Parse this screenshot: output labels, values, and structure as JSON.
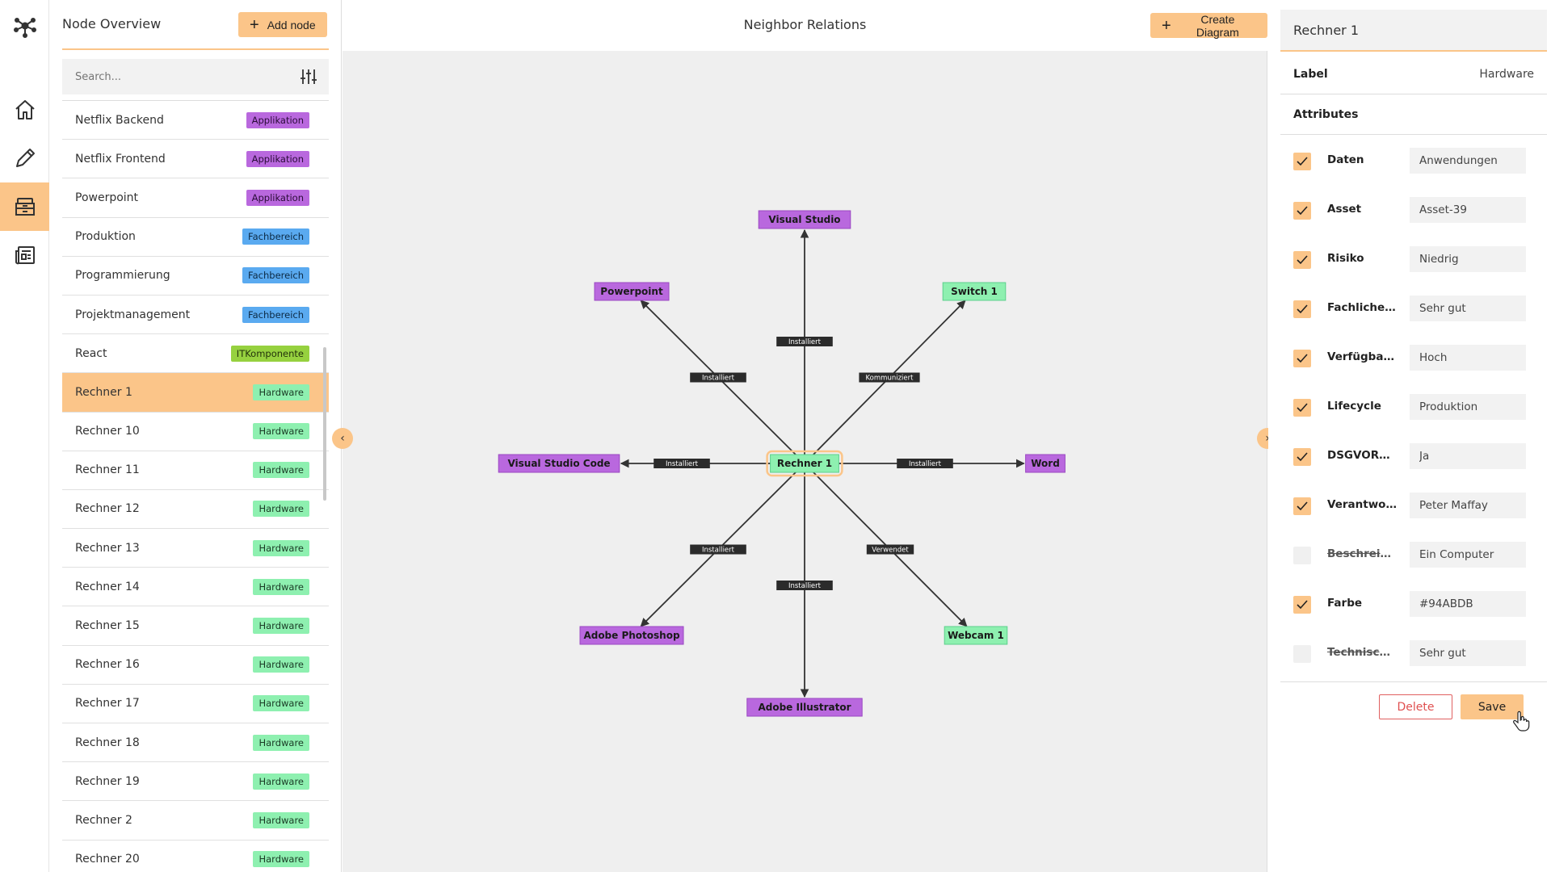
{
  "sidebar": {
    "items": [
      {
        "icon": "graph-logo-icon"
      },
      {
        "icon": "home-icon"
      },
      {
        "icon": "pencil-icon"
      },
      {
        "icon": "archive-icon",
        "active": true
      },
      {
        "icon": "newspaper-icon"
      }
    ]
  },
  "nodes_panel": {
    "title": "Node Overview",
    "add_label": "Add node",
    "search_placeholder": "Search...",
    "items": [
      {
        "label": "Netflix Backend",
        "badge": "Applikation",
        "type": "app"
      },
      {
        "label": "Netflix Frontend",
        "badge": "Applikation",
        "type": "app"
      },
      {
        "label": "Powerpoint",
        "badge": "Applikation",
        "type": "app"
      },
      {
        "label": "Produktion",
        "badge": "Fachbereich",
        "type": "fach"
      },
      {
        "label": "Programmierung",
        "badge": "Fachbereich",
        "type": "fach"
      },
      {
        "label": "Projektmanagement",
        "badge": "Fachbereich",
        "type": "fach"
      },
      {
        "label": "React",
        "badge": "ITKomponente",
        "type": "it"
      },
      {
        "label": "Rechner 1",
        "badge": "Hardware",
        "type": "hw",
        "selected": true
      },
      {
        "label": "Rechner 10",
        "badge": "Hardware",
        "type": "hw"
      },
      {
        "label": "Rechner 11",
        "badge": "Hardware",
        "type": "hw"
      },
      {
        "label": "Rechner 12",
        "badge": "Hardware",
        "type": "hw"
      },
      {
        "label": "Rechner 13",
        "badge": "Hardware",
        "type": "hw"
      },
      {
        "label": "Rechner 14",
        "badge": "Hardware",
        "type": "hw"
      },
      {
        "label": "Rechner 15",
        "badge": "Hardware",
        "type": "hw"
      },
      {
        "label": "Rechner 16",
        "badge": "Hardware",
        "type": "hw"
      },
      {
        "label": "Rechner 17",
        "badge": "Hardware",
        "type": "hw"
      },
      {
        "label": "Rechner 18",
        "badge": "Hardware",
        "type": "hw"
      },
      {
        "label": "Rechner 19",
        "badge": "Hardware",
        "type": "hw"
      },
      {
        "label": "Rechner 2",
        "badge": "Hardware",
        "type": "hw"
      },
      {
        "label": "Rechner 20",
        "badge": "Hardware",
        "type": "hw"
      }
    ]
  },
  "canvas": {
    "title": "Neighbor Relations",
    "create_label": "Create Diagram",
    "center": {
      "label": "Rechner 1",
      "type": "hw"
    },
    "neighbors": [
      {
        "label": "Visual Studio",
        "type": "app",
        "edge": "Installiert"
      },
      {
        "label": "Switch 1",
        "type": "hw",
        "edge": "Kommuniziert"
      },
      {
        "label": "Word",
        "type": "app",
        "edge": "Installiert"
      },
      {
        "label": "Webcam 1",
        "type": "hw",
        "edge": "Verwendet"
      },
      {
        "label": "Adobe Illustrator",
        "type": "app",
        "edge": "Installiert"
      },
      {
        "label": "Adobe Photoshop",
        "type": "app",
        "edge": "Installiert"
      },
      {
        "label": "Visual Studio Code",
        "type": "app",
        "edge": "Installiert"
      },
      {
        "label": "Powerpoint",
        "type": "app",
        "edge": "Installiert"
      }
    ]
  },
  "detail": {
    "name": "Rechner 1",
    "label_key": "Label",
    "label_value": "Hardware",
    "attributes_heading": "Attributes",
    "attributes": [
      {
        "name": "Daten",
        "value": "Anwendungen",
        "checked": true
      },
      {
        "name": "Asset",
        "value": "Asset-39",
        "checked": true
      },
      {
        "name": "Risiko",
        "value": "Niedrig",
        "checked": true
      },
      {
        "name": "FachlicheEi...",
        "value": "Sehr gut",
        "checked": true
      },
      {
        "name": "Verfügbark...",
        "value": "Hoch",
        "checked": true
      },
      {
        "name": "Lifecycle",
        "value": "Produktion",
        "checked": true
      },
      {
        "name": "DSGVORele...",
        "value": "Ja",
        "checked": true
      },
      {
        "name": "Verantwort...",
        "value": "Peter Maffay",
        "checked": true
      },
      {
        "name": "Beschreibu...",
        "value": "Ein Computer",
        "checked": false
      },
      {
        "name": "Farbe",
        "value": "#94ABDB",
        "checked": true
      },
      {
        "name": "Technische...",
        "value": "Sehr gut",
        "checked": false
      }
    ],
    "delete_label": "Delete",
    "save_label": "Save"
  },
  "colors": {
    "accent": "#fbc589",
    "app": "#b968de",
    "hw": "#8ef0b0",
    "fach": "#5aaaf0",
    "it": "#96d13f"
  }
}
